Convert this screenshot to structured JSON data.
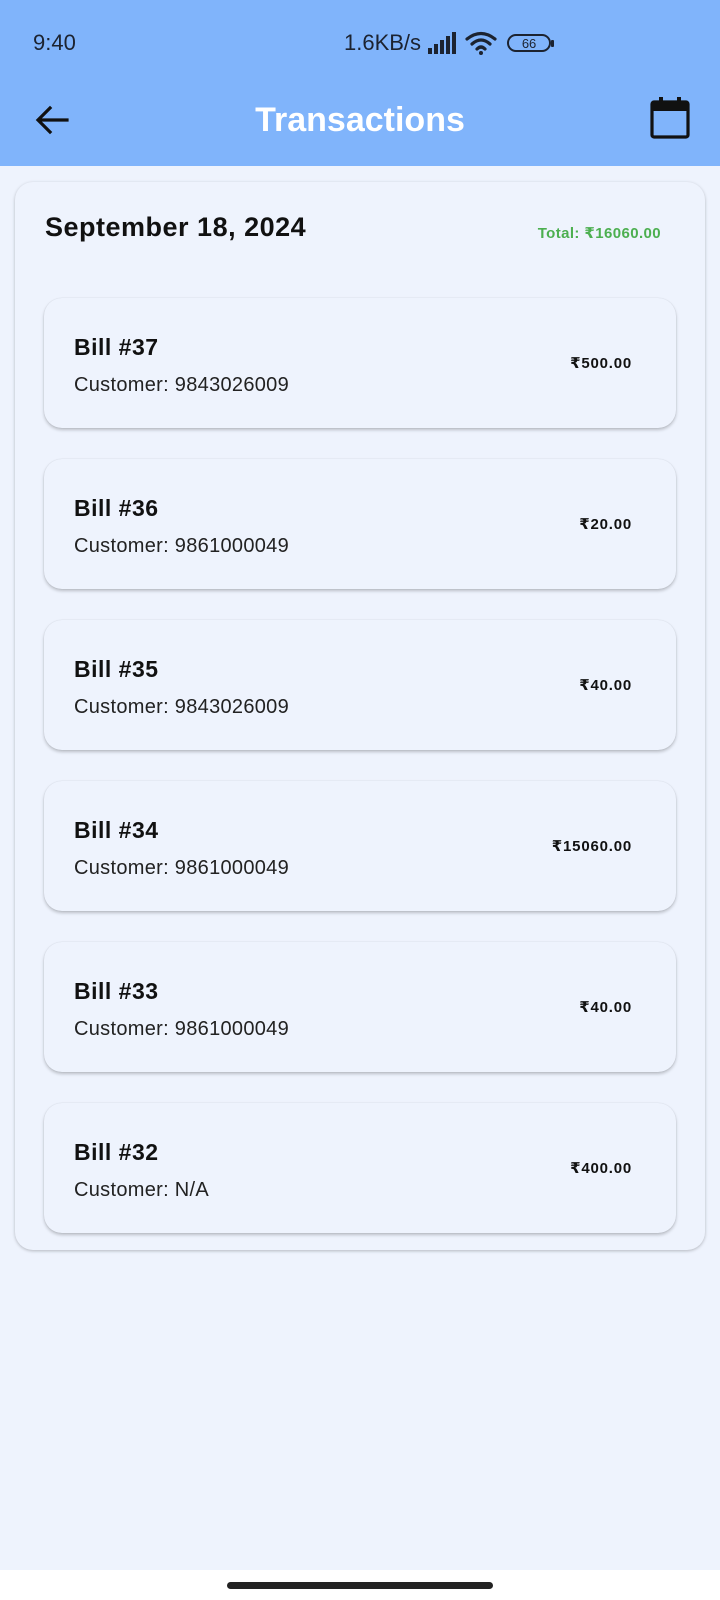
{
  "status_bar": {
    "time": "9:40",
    "net_speed": "1.6KB/s",
    "battery": "66",
    "icons": [
      "signal-icon",
      "wifi-icon",
      "battery-icon"
    ]
  },
  "app_bar": {
    "title": "Transactions",
    "back_icon": "arrow-left-icon",
    "calendar_icon": "calendar-icon",
    "background_color": "#80b4fb"
  },
  "summary": {
    "date": "September 18, 2024",
    "total": "Total: ₹16060.00",
    "total_color": "#4caf50"
  },
  "bills": [
    {
      "title": "Bill #37",
      "customer": "Customer: 9843026009",
      "amount": "₹500.00"
    },
    {
      "title": "Bill #36",
      "customer": "Customer: 9861000049",
      "amount": "₹20.00"
    },
    {
      "title": "Bill #35",
      "customer": "Customer: 9843026009",
      "amount": "₹40.00"
    },
    {
      "title": "Bill #34",
      "customer": "Customer: 9861000049",
      "amount": "₹15060.00"
    },
    {
      "title": "Bill #33",
      "customer": "Customer: 9861000049",
      "amount": "₹40.00"
    },
    {
      "title": "Bill #32",
      "customer": "Customer: N/A",
      "amount": "₹400.00"
    }
  ]
}
